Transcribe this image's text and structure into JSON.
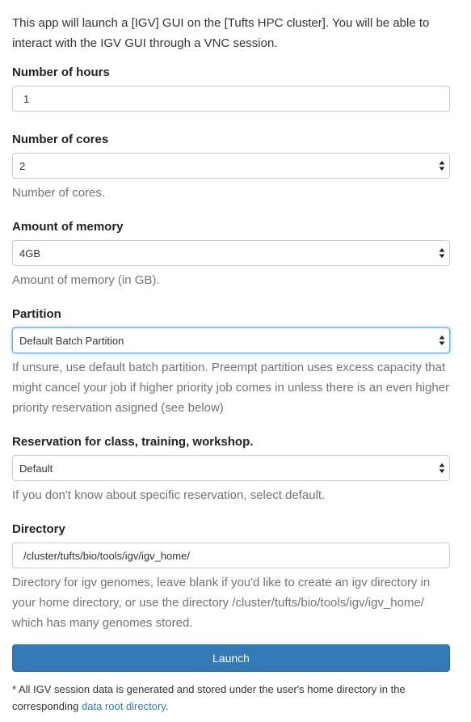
{
  "intro": "This app will launch a [IGV] GUI on the [Tufts HPC cluster]. You will be able to interact with the IGV GUI through a VNC session.",
  "fields": {
    "hours": {
      "label": "Number of hours",
      "value": "1"
    },
    "cores": {
      "label": "Number of cores",
      "value": "2",
      "help": "Number of cores."
    },
    "memory": {
      "label": "Amount of memory",
      "value": "4GB",
      "help": "Amount of memory (in GB)."
    },
    "partition": {
      "label": "Partition",
      "value": "Default Batch Partition",
      "help": "If unsure, use default batch partition. Preempt partition uses excess capacity that might cancel your job if higher priority job comes in unless there is an even higher priority reservation asigned (see below)"
    },
    "reservation": {
      "label": "Reservation for class, training, workshop.",
      "value": "Default",
      "help": "If you don't know about specific reservation, select default."
    },
    "directory": {
      "label": "Directory",
      "value": "/cluster/tufts/bio/tools/igv/igv_home/",
      "help": "Directory for igv genomes, leave blank if you'd like to create an igv directory in your home directory, or use the directory /cluster/tufts/bio/tools/igv/igv_home/ which has many genomes stored."
    }
  },
  "launch_label": "Launch",
  "footnote": {
    "text": "* All IGV session data is generated and stored under the user's home directory in the corresponding",
    "link": "data root directory",
    "end": "."
  },
  "colors": {
    "accent": "#337ab7",
    "focus": "#66afe9",
    "help_text": "#737373"
  }
}
